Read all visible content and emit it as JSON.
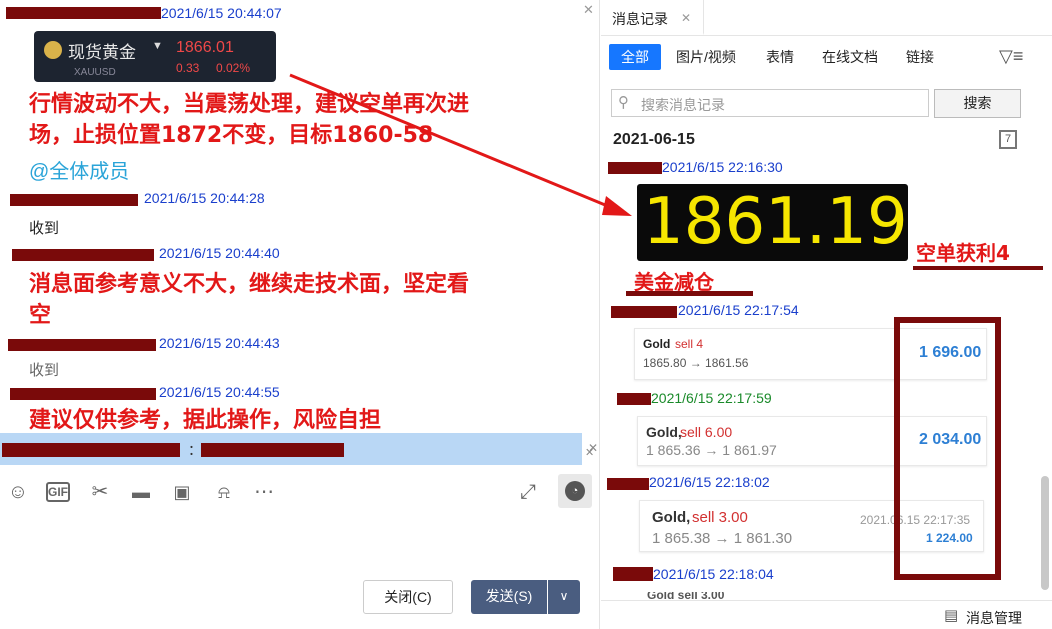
{
  "left": {
    "messages": [
      {
        "time": "2021/6/15 20:44:07"
      },
      {
        "time": "2021/6/15 20:44:28",
        "text": "收到"
      },
      {
        "time": "2021/6/15 20:44:40"
      },
      {
        "time": "2021/6/15 20:44:43",
        "text": "收到"
      },
      {
        "time": "2021/6/15 20:44:55"
      }
    ],
    "gold_card": {
      "name": "现货黄金",
      "code": "XAUUSD",
      "price": "1866.01",
      "change": "0.33",
      "pct": "0.02%"
    },
    "notes": {
      "n1_line1": "行情波动不大，当震荡处理，建议空单再次进",
      "n1_line2": "场，止损位置1872不变，目标1860-58",
      "mention": "@全体成员",
      "n2_line1": "消息面参考意义不大，继续走技术面，坚定看",
      "n2_line2": "空",
      "n3": "建议仅供参考，据此操作，风险自担"
    },
    "reply_colon": "：",
    "buttons": {
      "close": "关闭(C)",
      "send": "发送(S)"
    }
  },
  "right": {
    "panel_title": "消息记录",
    "tabs": [
      "全部",
      "图片/视频",
      "表情",
      "在线文档",
      "链接"
    ],
    "search": {
      "placeholder": "搜索消息记录",
      "button": "搜索"
    },
    "date": "2021-06-15",
    "calendar_day": "7",
    "entries": [
      {
        "time": "2021/6/15 22:16:30"
      },
      {
        "time": "2021/6/15 22:17:54"
      },
      {
        "time": "2021/6/15 22:17:59"
      },
      {
        "time": "2021/6/15 22:18:02"
      },
      {
        "time": "2021/6/15 22:18:04"
      }
    ],
    "big_price": "1861.19",
    "profit_note": "空单获利4",
    "dollar_note": "美金减仓",
    "trades": [
      {
        "sym": "Gold",
        "side": "sell 4",
        "prices": "1865.80 → 1861.56",
        "profit": "1 696.00"
      },
      {
        "sym": "Gold,",
        "side": "sell 6.00",
        "prices": "1 865.36 → 1 861.97",
        "profit": "2 034.00"
      },
      {
        "sym": "Gold,",
        "side": "sell 3.00",
        "prices": "1 865.38 → 1 861.30",
        "profit": "1 224.00",
        "time": "2021.06.15 22:17:35"
      }
    ],
    "partial_trade": "Gold sell 3.00",
    "manage": "消息管理"
  },
  "colors": {
    "accent": "#1677ff",
    "annotation": "#e21818",
    "redact": "#7a0a0a"
  }
}
